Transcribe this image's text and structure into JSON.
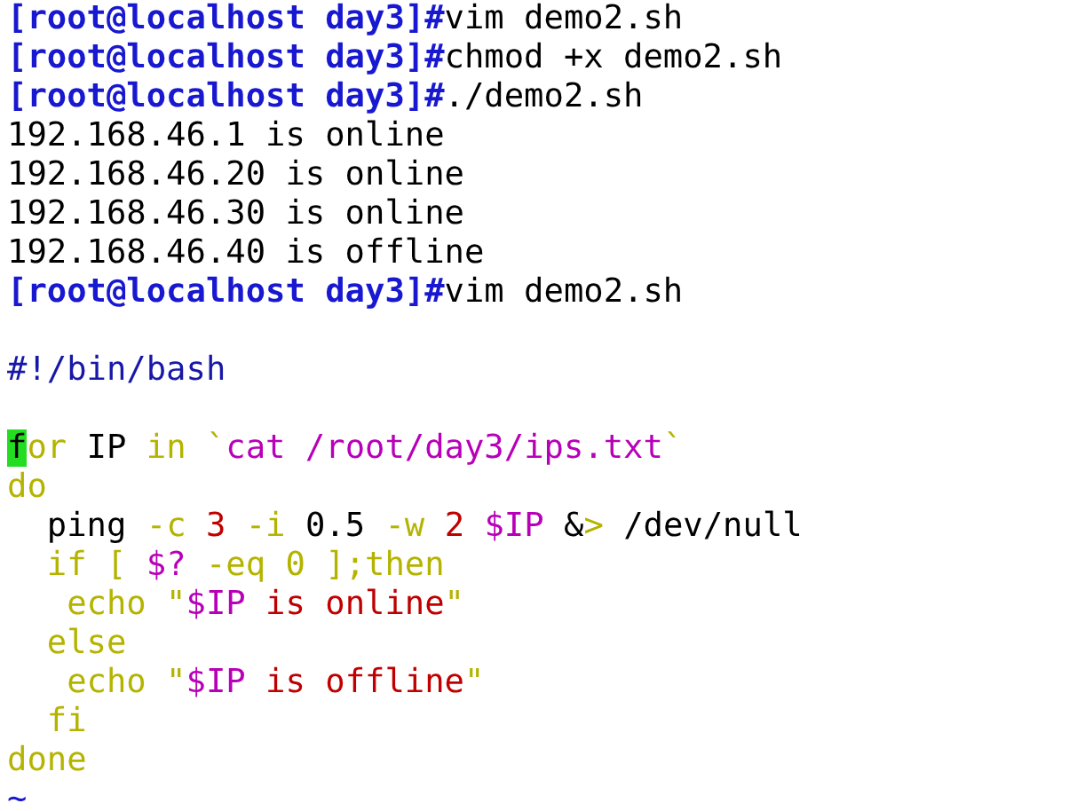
{
  "terminal": {
    "lines": [
      {
        "kind": "text",
        "segments": [
          {
            "text": "[root@localhost day3]#",
            "kind": "prompt"
          },
          {
            "text": "vim demo2.sh",
            "kind": "plain"
          }
        ]
      },
      {
        "kind": "text",
        "segments": [
          {
            "text": "[root@localhost day3]#",
            "kind": "prompt"
          },
          {
            "text": "chmod +x demo2.sh",
            "kind": "plain"
          }
        ]
      },
      {
        "kind": "text",
        "segments": [
          {
            "text": "[root@localhost day3]#",
            "kind": "prompt"
          },
          {
            "text": "./demo2.sh",
            "kind": "plain"
          }
        ]
      },
      {
        "kind": "text",
        "segments": [
          {
            "text": "192.168.46.1 is online",
            "kind": "plain"
          }
        ]
      },
      {
        "kind": "text",
        "segments": [
          {
            "text": "192.168.46.20 is online",
            "kind": "plain"
          }
        ]
      },
      {
        "kind": "text",
        "segments": [
          {
            "text": "192.168.46.30 is online",
            "kind": "plain"
          }
        ]
      },
      {
        "kind": "text",
        "segments": [
          {
            "text": "192.168.46.40 is offline",
            "kind": "plain"
          }
        ]
      },
      {
        "kind": "text",
        "segments": [
          {
            "text": "[root@localhost day3]#",
            "kind": "prompt"
          },
          {
            "text": "vim demo2.sh",
            "kind": "plain"
          }
        ]
      },
      {
        "kind": "blank"
      },
      {
        "kind": "text",
        "segments": [
          {
            "text": "#!/bin/bash",
            "kind": "comment"
          }
        ]
      },
      {
        "kind": "blank"
      },
      {
        "kind": "text",
        "segments": [
          {
            "text": "f",
            "kind": "cursor"
          },
          {
            "text": "or",
            "kind": "keyword"
          },
          {
            "text": " IP ",
            "kind": "plain"
          },
          {
            "text": "in",
            "kind": "keyword"
          },
          {
            "text": " `",
            "kind": "keyword"
          },
          {
            "text": "cat /root/day3/ips.txt",
            "kind": "variable"
          },
          {
            "text": "`",
            "kind": "keyword"
          }
        ]
      },
      {
        "kind": "text",
        "segments": [
          {
            "text": "do",
            "kind": "keyword"
          }
        ]
      },
      {
        "kind": "text",
        "segments": [
          {
            "text": "  ping ",
            "kind": "plain"
          },
          {
            "text": "-c",
            "kind": "keyword"
          },
          {
            "text": " 3",
            "kind": "number"
          },
          {
            "text": " -i",
            "kind": "keyword"
          },
          {
            "text": " 0.5 ",
            "kind": "plain"
          },
          {
            "text": "-w",
            "kind": "keyword"
          },
          {
            "text": " 2",
            "kind": "number"
          },
          {
            "text": " $IP",
            "kind": "variable"
          },
          {
            "text": " &",
            "kind": "plain"
          },
          {
            "text": ">",
            "kind": "keyword"
          },
          {
            "text": " /dev/null",
            "kind": "plain"
          }
        ]
      },
      {
        "kind": "text",
        "segments": [
          {
            "text": "  if [ ",
            "kind": "keyword"
          },
          {
            "text": "$?",
            "kind": "variable"
          },
          {
            "text": " -eq 0 ];then",
            "kind": "keyword"
          }
        ]
      },
      {
        "kind": "text",
        "segments": [
          {
            "text": "   echo \"",
            "kind": "keyword"
          },
          {
            "text": "$IP",
            "kind": "variable"
          },
          {
            "text": " is online",
            "kind": "number"
          },
          {
            "text": "\"",
            "kind": "keyword"
          }
        ]
      },
      {
        "kind": "text",
        "segments": [
          {
            "text": "  else",
            "kind": "keyword"
          }
        ]
      },
      {
        "kind": "text",
        "segments": [
          {
            "text": "   echo \"",
            "kind": "keyword"
          },
          {
            "text": "$IP",
            "kind": "variable"
          },
          {
            "text": " is offline",
            "kind": "number"
          },
          {
            "text": "\"",
            "kind": "keyword"
          }
        ]
      },
      {
        "kind": "text",
        "segments": [
          {
            "text": "  fi",
            "kind": "keyword"
          }
        ]
      },
      {
        "kind": "text",
        "segments": [
          {
            "text": "done",
            "kind": "keyword"
          }
        ]
      },
      {
        "kind": "text",
        "segments": [
          {
            "text": "~",
            "kind": "tilde"
          }
        ]
      }
    ]
  }
}
